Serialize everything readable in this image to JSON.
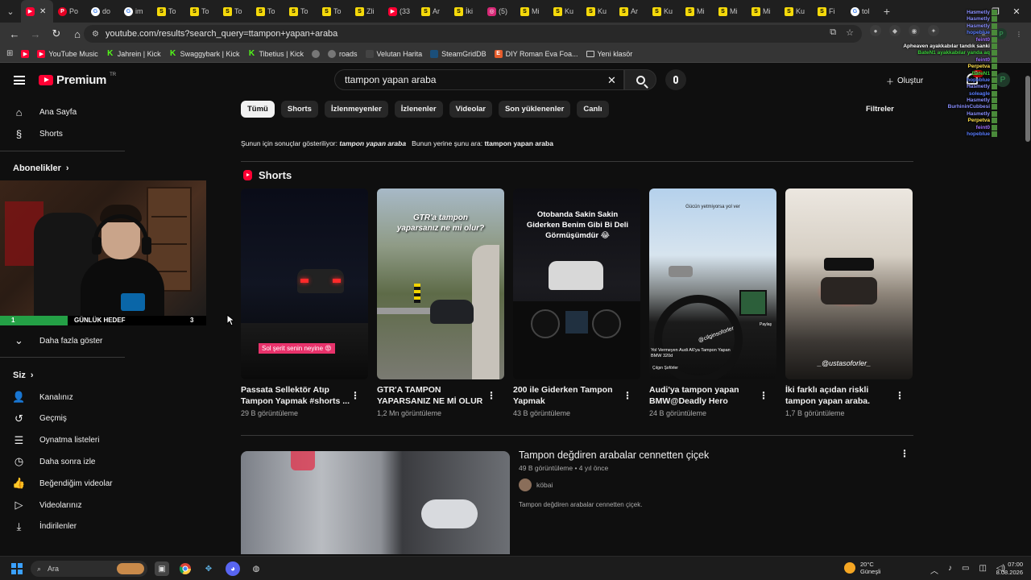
{
  "browser": {
    "tabs": [
      {
        "label": "",
        "fav": "yt",
        "glyph": "▶",
        "active": true
      },
      {
        "label": "Po",
        "fav": "pin",
        "glyph": "P"
      },
      {
        "label": "do",
        "fav": "goog",
        "glyph": "G"
      },
      {
        "label": "im",
        "fav": "goog",
        "glyph": "G"
      },
      {
        "label": "To",
        "fav": "s",
        "glyph": "S"
      },
      {
        "label": "To",
        "fav": "s",
        "glyph": "S"
      },
      {
        "label": "To",
        "fav": "s",
        "glyph": "S"
      },
      {
        "label": "To",
        "fav": "s",
        "glyph": "S"
      },
      {
        "label": "To",
        "fav": "s",
        "glyph": "S"
      },
      {
        "label": "To",
        "fav": "s",
        "glyph": "S"
      },
      {
        "label": "Zli",
        "fav": "s",
        "glyph": "S"
      },
      {
        "label": "(33",
        "fav": "yt",
        "glyph": "▶"
      },
      {
        "label": "Ar",
        "fav": "s",
        "glyph": "S"
      },
      {
        "label": "İki",
        "fav": "s",
        "glyph": "S"
      },
      {
        "label": "(5)",
        "fav": "ig",
        "glyph": "◎"
      },
      {
        "label": "Mi",
        "fav": "s",
        "glyph": "S"
      },
      {
        "label": "Ku",
        "fav": "s",
        "glyph": "S"
      },
      {
        "label": "Ku",
        "fav": "s",
        "glyph": "S"
      },
      {
        "label": "Ar",
        "fav": "s",
        "glyph": "S"
      },
      {
        "label": "Ku",
        "fav": "s",
        "glyph": "S"
      },
      {
        "label": "Mi",
        "fav": "s",
        "glyph": "S"
      },
      {
        "label": "Mi",
        "fav": "s",
        "glyph": "S"
      },
      {
        "label": "Mi",
        "fav": "s",
        "glyph": "S"
      },
      {
        "label": "Ku",
        "fav": "s",
        "glyph": "S"
      },
      {
        "label": "Fi",
        "fav": "s",
        "glyph": "S"
      },
      {
        "label": "tol",
        "fav": "goog",
        "glyph": "G"
      }
    ],
    "url": "youtube.com/results?search_query=ttampon+yapan+araba",
    "bookmarks": [
      {
        "label": "",
        "icon": "yt"
      },
      {
        "label": "YouTube Music",
        "icon": "yt"
      },
      {
        "label": "Jahrein | Kick",
        "icon": "kick"
      },
      {
        "label": "Swaggybark | Kick",
        "icon": "kick"
      },
      {
        "label": "Tibetius | Kick",
        "icon": "kick"
      },
      {
        "label": "",
        "icon": "globe"
      },
      {
        "label": "roads",
        "icon": "globe"
      },
      {
        "label": "Velutan Harita",
        "icon": "vel"
      },
      {
        "label": "SteamGridDB",
        "icon": "steam"
      },
      {
        "label": "DIY Roman Eva Foa...",
        "icon": "e"
      },
      {
        "label": "Yeni klasör",
        "icon": "folder"
      }
    ]
  },
  "header": {
    "logo_text": "Premium",
    "logo_region": "TR",
    "search_value": "ttampon yapan araba",
    "create_label": "Oluştur",
    "notif_count": "9+"
  },
  "sidebar": {
    "home": "Ana Sayfa",
    "shorts": "Shorts",
    "subscriptions": "Abonelikler",
    "show_more": "Daha fazla göster",
    "you": "Siz",
    "items": [
      {
        "label": "Kanalınız",
        "icon": "channel-icon",
        "glyph": "👤"
      },
      {
        "label": "Geçmiş",
        "icon": "history-icon",
        "glyph": "↺"
      },
      {
        "label": "Oynatma listeleri",
        "icon": "playlists-icon",
        "glyph": "☰"
      },
      {
        "label": "Daha sonra izle",
        "icon": "watch-later-icon",
        "glyph": "◷"
      },
      {
        "label": "Beğendiğim videolar",
        "icon": "like-icon",
        "glyph": "👍"
      },
      {
        "label": "Videolarınız",
        "icon": "your-videos-icon",
        "glyph": "▷"
      },
      {
        "label": "İndirilenler",
        "icon": "download-icon",
        "glyph": "⤓"
      }
    ]
  },
  "overlay": {
    "goal_label": "GÜNLÜK HEDEF",
    "goal_current": "1",
    "goal_target": "3",
    "goal_fraction": 0.33
  },
  "chips": [
    "Tümü",
    "Shorts",
    "İzlenmeyenler",
    "İzlenenler",
    "Videolar",
    "Son yüklenenler",
    "Canlı"
  ],
  "filters_label": "Filtreler",
  "results": {
    "showing_prefix": "Şunun için sonuçlar gösteriliyor:",
    "showing_query": "tampon yapan araba",
    "instead_prefix": "Bunun yerine şunu ara:",
    "instead_query": "ttampon yapan araba",
    "shorts_heading": "Shorts",
    "shorts": [
      {
        "title": "Passata Sellektör Atıp Tampon Yapmak #shorts ...",
        "views": "29 B görüntüleme",
        "overlay": "Sol şerit senin neyine 😡"
      },
      {
        "title": "GTR'A TAMPON YAPARSANIZ NE Mİ OLUR",
        "views": "1,2 Mn görüntüleme",
        "overlay": "GTR'a tampon yaparsanız ne mi olur?"
      },
      {
        "title": "200 ile Giderken Tampon Yapmak",
        "views": "43 B görüntüleme",
        "overlay": "Otobanda Sakin Sakin Giderken Benim Gibi Bi Deli Görmüşümdür 😂"
      },
      {
        "title": "Audi'ya tampon yapan BMW@Deadly Hero",
        "views": "24 B görüntüleme",
        "overlay": "Gücün yetmiyorsa yol ver",
        "watermark": "@cilginsoforler",
        "sub": "Yol Vermeyen Audi A6'ya Tampon Yapan BMW 320d",
        "channel": "Çılgın Şoförler",
        "share": "Paylaş"
      },
      {
        "title": "İki farklı açıdan riskli tampon yapan araba.",
        "views": "1,7 B görüntüleme",
        "overlay": "_@ustasoforler_"
      }
    ],
    "video": {
      "title": "Tampon değdiren arabalar cennetten çiçek",
      "meta": "49 B görüntüleme • 4 yıl önce",
      "channel": "köbai",
      "description": "Tampon değdiren arabalar cennetten çiçek."
    }
  },
  "chat": [
    {
      "name": "Hasmetly",
      "color": "#8a8fff"
    },
    {
      "name": "Hasmetly",
      "color": "#8a8fff"
    },
    {
      "name": "Hasmetly",
      "color": "#8a8fff"
    },
    {
      "name": "hopeblue",
      "color": "#5a7dff"
    },
    {
      "name": "feint0",
      "color": "#a070ff"
    },
    {
      "name": "Apheaven ayakkabılar tandık sanki",
      "color": "#ffffff"
    },
    {
      "name": "BateN1 ayakkabılar yanda aq",
      "color": "#3cd03c"
    },
    {
      "name": "feint0",
      "color": "#a070ff"
    },
    {
      "name": "Perpetva",
      "color": "#ffe04a"
    },
    {
      "name": "BateN1",
      "color": "#3cd03c"
    },
    {
      "name": "hopeblue",
      "color": "#5a7dff"
    },
    {
      "name": "Hasmetly",
      "color": "#8a8fff"
    },
    {
      "name": "soleagle",
      "color": "#5a7dff"
    },
    {
      "name": "Hasmetly",
      "color": "#8a8fff"
    },
    {
      "name": "BurhininCubbesi",
      "color": "#8a8fff"
    },
    {
      "name": "Hasmetly",
      "color": "#8a8fff"
    },
    {
      "name": "Perpetva",
      "color": "#ffe04a"
    },
    {
      "name": "feint0",
      "color": "#a070ff"
    },
    {
      "name": "hopeblue",
      "color": "#5a7dff"
    }
  ],
  "taskbar": {
    "search_placeholder": "Ara",
    "weather_temp": "20°C",
    "weather_desc": "Güneşli",
    "time": "07:00",
    "date": "8.08.2026"
  }
}
